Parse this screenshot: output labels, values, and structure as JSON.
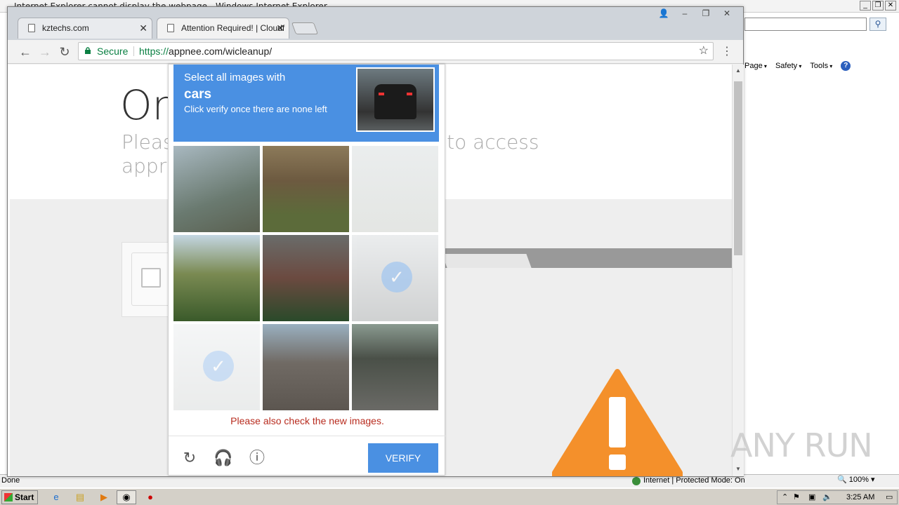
{
  "ie": {
    "title": "Internet Explorer cannot display the webpage - Windows Internet Explorer",
    "commands": [
      "Page",
      "Safety",
      "Tools"
    ],
    "status_left": "Done",
    "status_zone": "Internet | Protected Mode: On",
    "zoom": "100%",
    "search_icon": "search-icon"
  },
  "chrome": {
    "tabs": [
      {
        "label": "kztechs.com"
      },
      {
        "label": "Attention Required! | Cloudf"
      }
    ],
    "security_label": "Secure",
    "url_proto": "https://",
    "url_rest": "appnee.com/wicleanup/"
  },
  "page": {
    "heading": "On",
    "sub_left": "Pleas",
    "sub_right": "k to access",
    "sub_line2": "appr"
  },
  "captcha": {
    "instruction": "Select all images with",
    "target": "cars",
    "hint": "Click verify once there are none left",
    "message": "Please also check the new images.",
    "verify_label": "VERIFY",
    "accent": "#4a90e2",
    "error_color": "#b82c1f",
    "tiles": [
      {
        "selected": false
      },
      {
        "selected": false
      },
      {
        "selected": false
      },
      {
        "selected": false
      },
      {
        "selected": false
      },
      {
        "selected": true
      },
      {
        "selected": true
      },
      {
        "selected": false
      },
      {
        "selected": false
      }
    ]
  },
  "taskbar": {
    "start_label": "Start",
    "time": "3:25 AM"
  },
  "watermark": "ANY RUN"
}
